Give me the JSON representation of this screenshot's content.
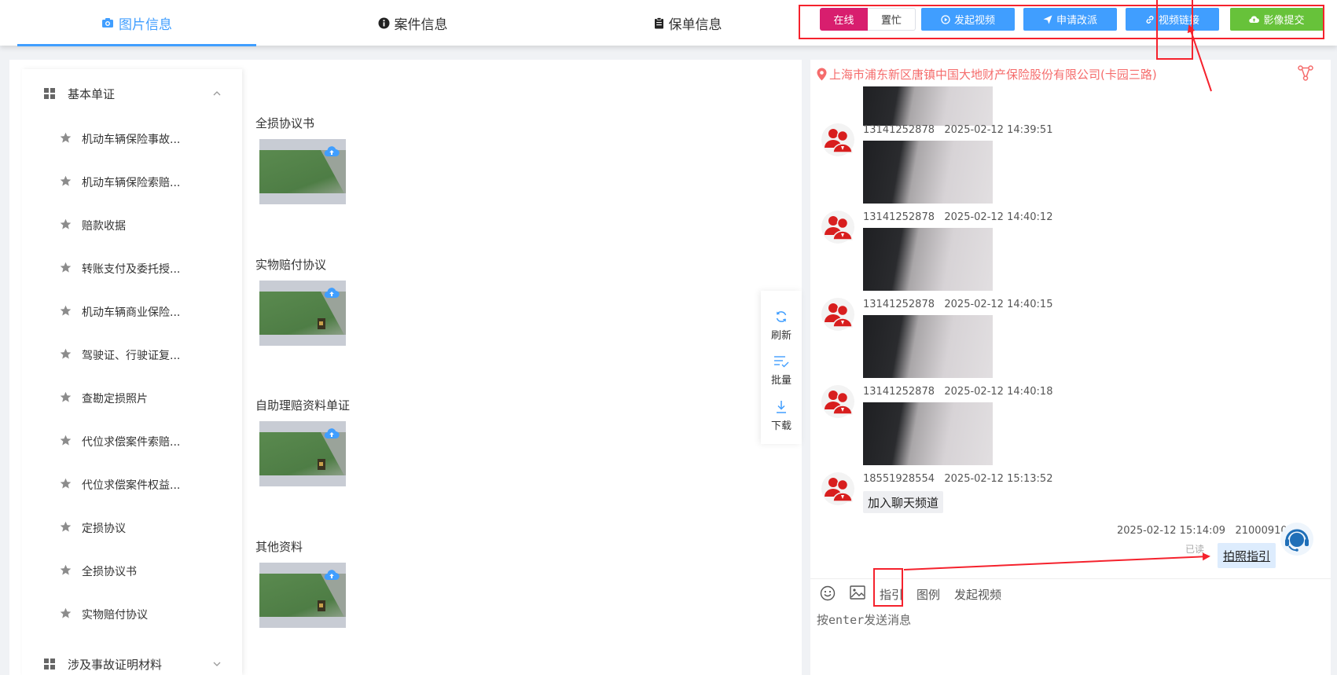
{
  "tabs": [
    {
      "label": "图片信息",
      "icon": "camera-icon",
      "active": true
    },
    {
      "label": "案件信息",
      "icon": "info-icon",
      "active": false
    },
    {
      "label": "保单信息",
      "icon": "clipboard-icon",
      "active": false
    }
  ],
  "status": {
    "online_label": "在线",
    "busy_label": "置忙"
  },
  "actions": {
    "start_video": "发起视频",
    "apply_reassign": "申请改派",
    "video_link": "视频链接",
    "submit_images": "影像提交"
  },
  "sidebar": {
    "groups": [
      {
        "label": "基本单证",
        "expanded": true,
        "items": [
          {
            "label": "机动车辆保险事故..."
          },
          {
            "label": "机动车辆保险索赔..."
          },
          {
            "label": "赔款收据"
          },
          {
            "label": "转账支付及委托授..."
          },
          {
            "label": "机动车辆商业保险..."
          },
          {
            "label": "驾驶证、行驶证复..."
          },
          {
            "label": "查勘定损照片"
          },
          {
            "label": "代位求偿案件索赔..."
          },
          {
            "label": "代位求偿案件权益..."
          },
          {
            "label": "定损协议"
          },
          {
            "label": "全损协议书"
          },
          {
            "label": "实物赔付协议"
          }
        ]
      },
      {
        "label": "涉及事故证明材料",
        "expanded": false,
        "items": []
      }
    ]
  },
  "sections": [
    {
      "title": "全损协议书"
    },
    {
      "title": "实物赔付协议"
    },
    {
      "title": "自助理赔资料单证"
    },
    {
      "title": "其他资料"
    }
  ],
  "float_tools": {
    "refresh": "刷新",
    "batch": "批量",
    "download": "下载"
  },
  "chat": {
    "address": "上海市浦东新区唐镇中国大地财产保险股份有限公司(卡园三路)",
    "messages": [
      {
        "sender": "13141252878",
        "time": "2025-02-12 14:39:51",
        "type": "image"
      },
      {
        "sender": "13141252878",
        "time": "2025-02-12 14:40:12",
        "type": "image"
      },
      {
        "sender": "13141252878",
        "time": "2025-02-12 14:40:15",
        "type": "image"
      },
      {
        "sender": "13141252878",
        "time": "2025-02-12 14:40:18",
        "type": "image"
      },
      {
        "sender": "18551928554",
        "time": "2025-02-12 15:13:52",
        "type": "text",
        "text": "加入聊天频道"
      }
    ],
    "self_message": {
      "time": "2025-02-12 15:14:09",
      "sender": "210009105",
      "read": "已读",
      "text": "拍照指引"
    },
    "toolbar": {
      "guide": "指引",
      "example": "图例",
      "start_video": "发起视频"
    },
    "input_placeholder": "按enter发送消息"
  },
  "colors": {
    "accent": "#409eff",
    "online": "#d81e6e",
    "green": "#67c23a",
    "address": "#f56c6c",
    "annotation": "#f5222d"
  }
}
